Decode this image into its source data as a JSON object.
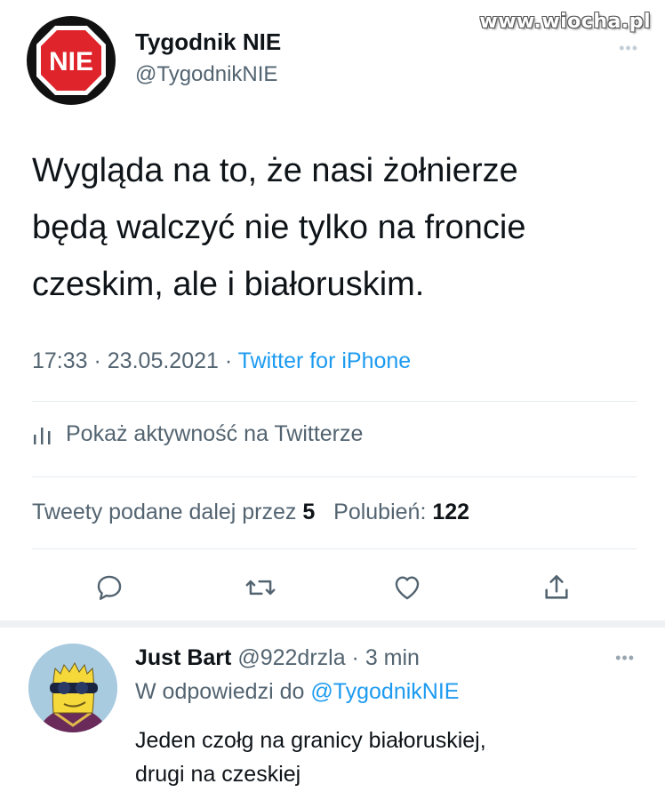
{
  "watermark": "www.wiocha.pl",
  "tweet": {
    "author": {
      "name": "Tygodnik NIE",
      "handle": "@TygodnikNIE",
      "avatar_text": "NIE",
      "avatar_colors": {
        "ring": "#111111",
        "octagon": "#e0242b"
      }
    },
    "text_lines": [
      "Wygląda na to, że nasi żołnierze",
      "będą walczyć nie tylko na froncie",
      "czeskim, ale i białoruskim."
    ],
    "time": "17:33",
    "date": "23.05.2021",
    "client": "Twitter for iPhone",
    "activity_label": "Pokaż aktywność na Twitterze",
    "retweets_label": "Tweety podane dalej przez",
    "retweets_count": "5",
    "likes_label": "Polubień:",
    "likes_count": "122",
    "actions": [
      {
        "icon": "reply-icon"
      },
      {
        "icon": "retweet-icon"
      },
      {
        "icon": "like-icon"
      },
      {
        "icon": "share-icon"
      }
    ]
  },
  "reply": {
    "name": "Just Bart",
    "handle": "@922drzla",
    "time": "3 min",
    "reply_to_prefix": "W odpowiedzi do",
    "reply_to_handle": "@TygodnikNIE",
    "text_lines": [
      "Jeden czołg na granicy białoruskiej,",
      "drugi na czeskiej"
    ]
  },
  "colors": {
    "accent": "#1d9bf0",
    "text_primary": "#0f1419",
    "text_secondary": "#536471",
    "divider": "#e6ecf0"
  }
}
